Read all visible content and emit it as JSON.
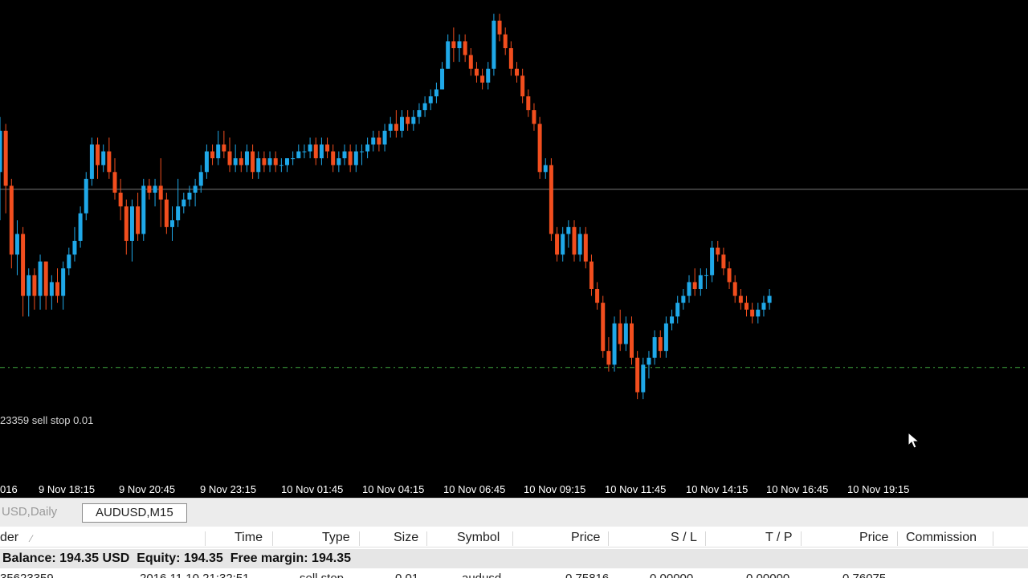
{
  "chart": {
    "symbol": "AUDUSD",
    "timeframe": "M15",
    "order_label": "23359 sell stop 0.01",
    "bull_color": "#1fa8e8",
    "bear_color": "#f24e1e",
    "current_price_line_color": "#c9c9c9",
    "order_line_color": "#3fa83f",
    "time_ticks": [
      "016",
      "9 Nov 18:15",
      "9 Nov 20:45",
      "9 Nov 23:15",
      "10 Nov 01:45",
      "10 Nov 04:15",
      "10 Nov 06:45",
      "10 Nov 09:15",
      "10 Nov 11:45",
      "10 Nov 14:15",
      "10 Nov 16:45",
      "10 Nov 19:15"
    ]
  },
  "chart_data": {
    "type": "candlestick",
    "title": "",
    "xlabel": "",
    "ylabel": "",
    "ylim": [
      0.7565,
      0.7635
    ],
    "current_price": 0.76075,
    "sell_stop_price": 0.75816,
    "candles": [
      [
        0.761,
        0.7618,
        0.7603,
        0.7616
      ],
      [
        0.7616,
        0.7617,
        0.7604,
        0.7608
      ],
      [
        0.7608,
        0.7609,
        0.7596,
        0.7598
      ],
      [
        0.7598,
        0.7603,
        0.7595,
        0.7601
      ],
      [
        0.7601,
        0.7602,
        0.7589,
        0.7592
      ],
      [
        0.7592,
        0.7596,
        0.7589,
        0.7595
      ],
      [
        0.7595,
        0.7596,
        0.759,
        0.7592
      ],
      [
        0.7592,
        0.7598,
        0.759,
        0.7597
      ],
      [
        0.7597,
        0.7597,
        0.759,
        0.7592
      ],
      [
        0.7592,
        0.7595,
        0.759,
        0.7594
      ],
      [
        0.7594,
        0.7596,
        0.7591,
        0.7592
      ],
      [
        0.7592,
        0.7597,
        0.759,
        0.7596
      ],
      [
        0.7596,
        0.7599,
        0.7595,
        0.7598
      ],
      [
        0.7598,
        0.7602,
        0.7597,
        0.76
      ],
      [
        0.76,
        0.7605,
        0.7599,
        0.7604
      ],
      [
        0.7604,
        0.761,
        0.7603,
        0.7609
      ],
      [
        0.7609,
        0.7615,
        0.7608,
        0.7614
      ],
      [
        0.7614,
        0.7615,
        0.7609,
        0.7611
      ],
      [
        0.7611,
        0.7614,
        0.761,
        0.7613
      ],
      [
        0.7613,
        0.7615,
        0.7609,
        0.761
      ],
      [
        0.761,
        0.7612,
        0.7606,
        0.7607
      ],
      [
        0.7607,
        0.7609,
        0.7603,
        0.7605
      ],
      [
        0.7605,
        0.7606,
        0.7598,
        0.76
      ],
      [
        0.76,
        0.7606,
        0.7597,
        0.7605
      ],
      [
        0.7605,
        0.7607,
        0.76,
        0.7601
      ],
      [
        0.7601,
        0.7609,
        0.76,
        0.7608
      ],
      [
        0.7608,
        0.7609,
        0.7606,
        0.7607
      ],
      [
        0.7607,
        0.7609,
        0.7605,
        0.7608
      ],
      [
        0.7608,
        0.7612,
        0.7602,
        0.7606
      ],
      [
        0.7606,
        0.7607,
        0.7601,
        0.7602
      ],
      [
        0.7602,
        0.7605,
        0.76,
        0.7603
      ],
      [
        0.7603,
        0.7609,
        0.7602,
        0.7605
      ],
      [
        0.7605,
        0.7607,
        0.7604,
        0.7606
      ],
      [
        0.7606,
        0.7608,
        0.7605,
        0.7607
      ],
      [
        0.7607,
        0.7609,
        0.7605,
        0.7608
      ],
      [
        0.7608,
        0.7611,
        0.7607,
        0.761
      ],
      [
        0.761,
        0.7614,
        0.7609,
        0.7613
      ],
      [
        0.7613,
        0.7614,
        0.7611,
        0.7612
      ],
      [
        0.7612,
        0.7616,
        0.7611,
        0.7614
      ],
      [
        0.7614,
        0.7616,
        0.7612,
        0.7613
      ],
      [
        0.7613,
        0.7615,
        0.761,
        0.7611
      ],
      [
        0.7611,
        0.7614,
        0.761,
        0.7612
      ],
      [
        0.7612,
        0.7613,
        0.761,
        0.7611
      ],
      [
        0.7611,
        0.7614,
        0.761,
        0.7613
      ],
      [
        0.7613,
        0.7614,
        0.7609,
        0.761
      ],
      [
        0.761,
        0.7613,
        0.7609,
        0.7612
      ],
      [
        0.7612,
        0.7613,
        0.761,
        0.7611
      ],
      [
        0.7611,
        0.7613,
        0.761,
        0.7612
      ],
      [
        0.7612,
        0.7613,
        0.761,
        0.7611
      ],
      [
        0.7611,
        0.7612,
        0.761,
        0.7611
      ],
      [
        0.7611,
        0.7612,
        0.761,
        0.7612
      ],
      [
        0.7612,
        0.7613,
        0.7611,
        0.7612
      ],
      [
        0.7612,
        0.7614,
        0.7612,
        0.7613
      ],
      [
        0.7613,
        0.7614,
        0.7612,
        0.7613
      ],
      [
        0.7613,
        0.7615,
        0.7612,
        0.7614
      ],
      [
        0.7614,
        0.7615,
        0.7611,
        0.7612
      ],
      [
        0.7612,
        0.7615,
        0.7611,
        0.7614
      ],
      [
        0.7614,
        0.7615,
        0.7612,
        0.7613
      ],
      [
        0.7613,
        0.7614,
        0.761,
        0.7611
      ],
      [
        0.7611,
        0.7613,
        0.761,
        0.7612
      ],
      [
        0.7612,
        0.7614,
        0.7611,
        0.7613
      ],
      [
        0.7613,
        0.7614,
        0.761,
        0.7611
      ],
      [
        0.7611,
        0.7614,
        0.761,
        0.7613
      ],
      [
        0.7613,
        0.7614,
        0.7611,
        0.7613
      ],
      [
        0.7613,
        0.7615,
        0.7612,
        0.7614
      ],
      [
        0.7614,
        0.7616,
        0.7613,
        0.7615
      ],
      [
        0.7615,
        0.7616,
        0.7613,
        0.7614
      ],
      [
        0.7614,
        0.7617,
        0.7613,
        0.7616
      ],
      [
        0.7616,
        0.7618,
        0.7615,
        0.7617
      ],
      [
        0.7617,
        0.7619,
        0.7615,
        0.7616
      ],
      [
        0.7616,
        0.7619,
        0.7615,
        0.7618
      ],
      [
        0.7618,
        0.7619,
        0.7616,
        0.7617
      ],
      [
        0.7617,
        0.7619,
        0.7616,
        0.7618
      ],
      [
        0.7618,
        0.762,
        0.7617,
        0.7619
      ],
      [
        0.7619,
        0.7621,
        0.7618,
        0.762
      ],
      [
        0.762,
        0.7622,
        0.7619,
        0.7621
      ],
      [
        0.7621,
        0.7623,
        0.762,
        0.7622
      ],
      [
        0.7622,
        0.7626,
        0.7622,
        0.7625
      ],
      [
        0.7625,
        0.763,
        0.7625,
        0.7629
      ],
      [
        0.7629,
        0.7631,
        0.7626,
        0.7628
      ],
      [
        0.7628,
        0.763,
        0.7626,
        0.7629
      ],
      [
        0.7629,
        0.763,
        0.7626,
        0.7627
      ],
      [
        0.7627,
        0.7628,
        0.7624,
        0.7625
      ],
      [
        0.7625,
        0.7626,
        0.7623,
        0.7624
      ],
      [
        0.7624,
        0.7625,
        0.7622,
        0.7623
      ],
      [
        0.7623,
        0.7626,
        0.7622,
        0.7625
      ],
      [
        0.7625,
        0.7633,
        0.7624,
        0.7632
      ],
      [
        0.7632,
        0.7633,
        0.7629,
        0.763
      ],
      [
        0.763,
        0.7631,
        0.7627,
        0.7628
      ],
      [
        0.7628,
        0.7629,
        0.7624,
        0.7625
      ],
      [
        0.7625,
        0.7626,
        0.7623,
        0.7624
      ],
      [
        0.7624,
        0.7625,
        0.762,
        0.7621
      ],
      [
        0.7621,
        0.7622,
        0.7618,
        0.7619
      ],
      [
        0.7619,
        0.762,
        0.7616,
        0.7617
      ],
      [
        0.7617,
        0.7618,
        0.7609,
        0.761
      ],
      [
        0.761,
        0.7612,
        0.7609,
        0.7611
      ],
      [
        0.7611,
        0.7612,
        0.76,
        0.7601
      ],
      [
        0.7601,
        0.7602,
        0.7597,
        0.7598
      ],
      [
        0.7598,
        0.7602,
        0.7597,
        0.7601
      ],
      [
        0.7601,
        0.7603,
        0.7599,
        0.7602
      ],
      [
        0.7602,
        0.7603,
        0.7597,
        0.7598
      ],
      [
        0.7598,
        0.7602,
        0.7597,
        0.7601
      ],
      [
        0.7601,
        0.7602,
        0.7596,
        0.7597
      ],
      [
        0.7597,
        0.7598,
        0.7592,
        0.7593
      ],
      [
        0.7593,
        0.7594,
        0.759,
        0.7591
      ],
      [
        0.7591,
        0.7592,
        0.7583,
        0.7584
      ],
      [
        0.7584,
        0.7586,
        0.7581,
        0.7582
      ],
      [
        0.7582,
        0.7589,
        0.7581,
        0.7588
      ],
      [
        0.7588,
        0.759,
        0.7584,
        0.7585
      ],
      [
        0.7585,
        0.7589,
        0.7584,
        0.7588
      ],
      [
        0.7588,
        0.7589,
        0.7582,
        0.7583
      ],
      [
        0.7583,
        0.7584,
        0.7577,
        0.7578
      ],
      [
        0.7578,
        0.7583,
        0.7577,
        0.7582
      ],
      [
        0.7582,
        0.7584,
        0.758,
        0.7583
      ],
      [
        0.7583,
        0.7587,
        0.7582,
        0.7586
      ],
      [
        0.7586,
        0.7587,
        0.7583,
        0.7584
      ],
      [
        0.7584,
        0.7589,
        0.7583,
        0.7588
      ],
      [
        0.7588,
        0.759,
        0.7587,
        0.7589
      ],
      [
        0.7589,
        0.7592,
        0.7588,
        0.7591
      ],
      [
        0.7591,
        0.7593,
        0.759,
        0.7592
      ],
      [
        0.7592,
        0.7595,
        0.7591,
        0.7594
      ],
      [
        0.7594,
        0.7596,
        0.7592,
        0.7593
      ],
      [
        0.7593,
        0.7596,
        0.7592,
        0.7595
      ],
      [
        0.7595,
        0.7596,
        0.7593,
        0.7595
      ],
      [
        0.7595,
        0.76,
        0.7594,
        0.7599
      ],
      [
        0.7599,
        0.76,
        0.7597,
        0.7598
      ],
      [
        0.7598,
        0.7599,
        0.7595,
        0.7596
      ],
      [
        0.7596,
        0.7597,
        0.7593,
        0.7594
      ],
      [
        0.7594,
        0.7595,
        0.7591,
        0.7592
      ],
      [
        0.7592,
        0.7593,
        0.759,
        0.7591
      ],
      [
        0.7591,
        0.7592,
        0.7589,
        0.759
      ],
      [
        0.759,
        0.7591,
        0.7588,
        0.7589
      ],
      [
        0.7589,
        0.7591,
        0.7588,
        0.759
      ],
      [
        0.759,
        0.7592,
        0.7589,
        0.7591
      ],
      [
        0.7591,
        0.7593,
        0.759,
        0.7592
      ]
    ]
  },
  "tabs": [
    {
      "label": "USD,Daily",
      "active": false
    },
    {
      "label": "AUDUSD,M15",
      "active": true
    }
  ],
  "terminal": {
    "columns": [
      "der",
      "Time",
      "Type",
      "Size",
      "Symbol",
      "Price",
      "S / L",
      "T / P",
      "Price",
      "Commission"
    ],
    "balance_text": "Balance: 194.35 USD  Equity: 194.35  Free margin: 194.35",
    "order_row": [
      "35623359",
      "2016.11.10 21:32:51",
      "sell stop",
      "0.01",
      "audusd",
      "0.75816",
      "0.00000",
      "0.00000",
      "0.76075",
      ""
    ]
  }
}
